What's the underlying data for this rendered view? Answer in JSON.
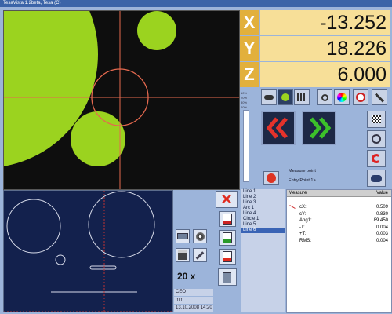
{
  "window": {
    "title": "TesaVista 1.2beta, Tesa (C)"
  },
  "dro": {
    "x_label": "X",
    "x_value": "-13.252",
    "y_label": "Y",
    "y_value": "18.226",
    "z_label": "Z",
    "z_value": "6.000"
  },
  "scale_labels": [
    "10%",
    "20%",
    "30%",
    "40%"
  ],
  "measure": {
    "prompt": "Measure point",
    "entry": "Entry Point 1>"
  },
  "features": [
    "Line 1",
    "Line 2",
    "Line 3",
    "Arc 1",
    "Line 4",
    "Circle 1",
    "Line 5",
    "Line 6"
  ],
  "results": {
    "header_measure": "Measure",
    "header_value": "Value",
    "rows": [
      {
        "label": "cX:",
        "value": "0.509"
      },
      {
        "label": "cY:",
        "value": "-0.830"
      },
      {
        "label": "Ang1:",
        "value": "89.450"
      },
      {
        "label": "-T:",
        "value": "0.004"
      },
      {
        "label": "+T:",
        "value": "0.003"
      },
      {
        "label": "RMS:",
        "value": "0.004"
      }
    ]
  },
  "zoom": "20 x",
  "status": {
    "user": "CEO",
    "unit": "mm",
    "date": "13.10.2008 14:20"
  },
  "colors": {
    "dro_label": "#e2b03c",
    "dro_value": "#f7df98",
    "camera_feature": "#9bd31f",
    "crosshair": "#e5694f"
  }
}
